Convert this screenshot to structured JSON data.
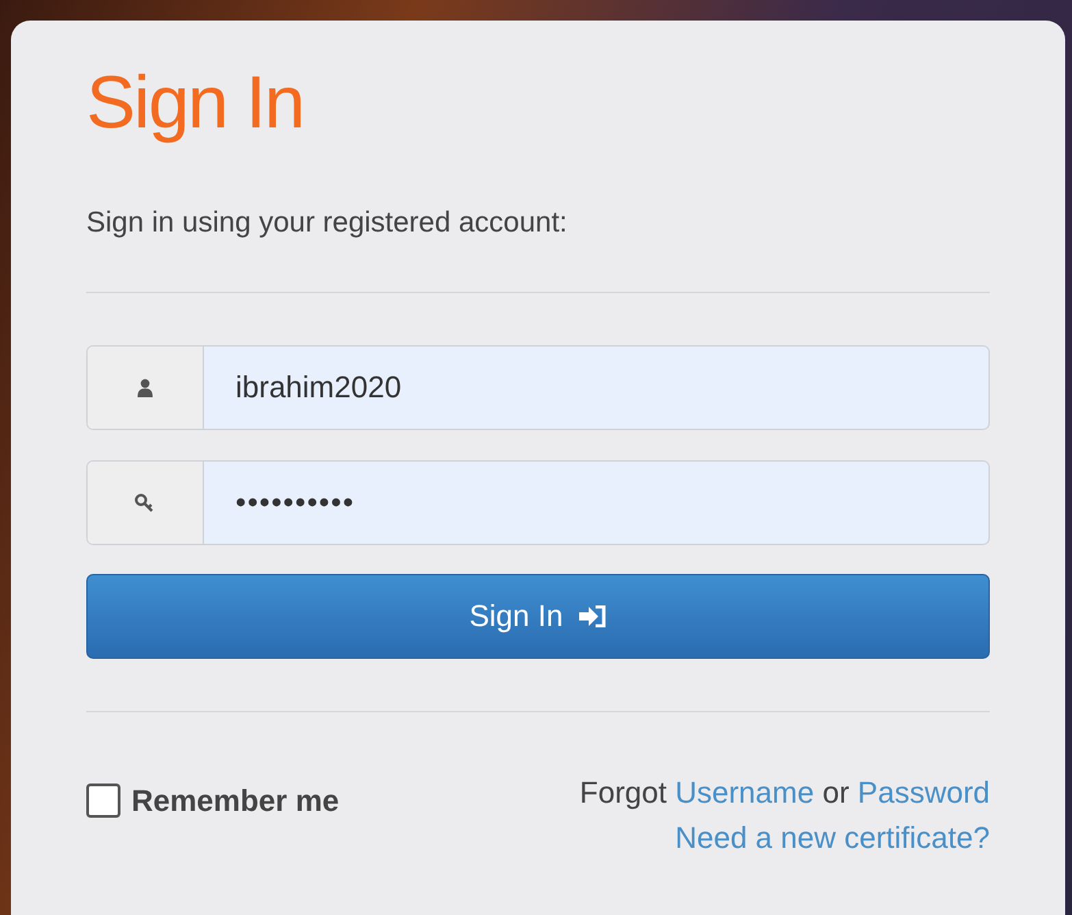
{
  "title": "Sign In",
  "subtitle": "Sign in using your registered account:",
  "fields": [
    {
      "kind": "username",
      "value": "ibrahim2020"
    },
    {
      "kind": "password",
      "value": "••••••••••"
    }
  ],
  "submit": {
    "label": "Sign In"
  },
  "remember": {
    "label": "Remember me",
    "checked": false
  },
  "forgot": {
    "prefix": "Forgot",
    "username_link": "Username",
    "middle": "or",
    "password_link": "Password"
  },
  "certificate_link": "Need a new certificate?"
}
